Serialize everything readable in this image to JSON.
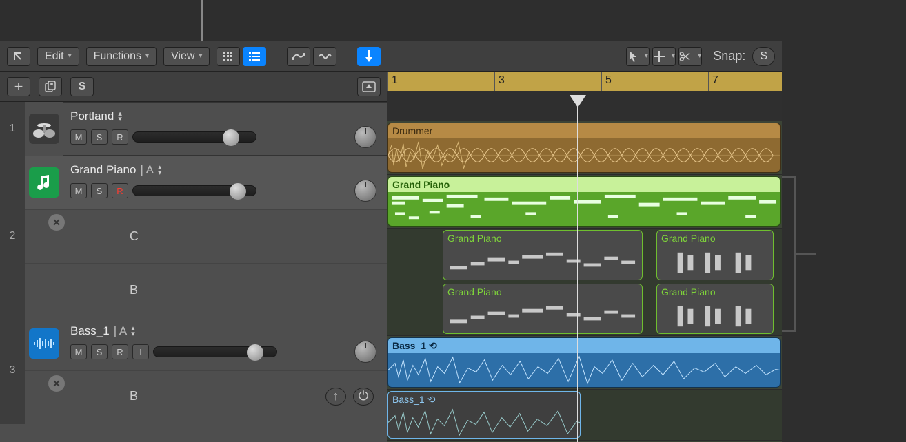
{
  "toolbar": {
    "back_icon": "↖",
    "edit": "Edit",
    "functions": "Functions",
    "view": "View",
    "snap_label": "Snap:",
    "snap_value": "S"
  },
  "subtoolbar": {
    "add": "+",
    "dup": "⎘",
    "solo": "S"
  },
  "ruler": {
    "bars": [
      "1",
      "3",
      "5",
      "7"
    ]
  },
  "tracks": [
    {
      "num": "1",
      "name": "Portland",
      "icon": "drumkit",
      "btns": [
        "M",
        "S",
        "R"
      ],
      "rec_index": -1,
      "lanes": []
    },
    {
      "num": "2",
      "name": "Grand Piano",
      "suffix": "| A",
      "icon": "midi",
      "btns": [
        "M",
        "S",
        "R"
      ],
      "rec_index": 2,
      "lanes": [
        "C",
        "B"
      ]
    },
    {
      "num": "3",
      "name": "Bass_1",
      "suffix": "| A",
      "icon": "audio",
      "btns": [
        "M",
        "S",
        "R",
        "I"
      ],
      "rec_index": -1,
      "lanes": [
        "B"
      ]
    }
  ],
  "regions": {
    "drummer": "Drummer",
    "piano_main": "Grand Piano",
    "piano_alt": "Grand Piano",
    "bass": "Bass_1"
  }
}
